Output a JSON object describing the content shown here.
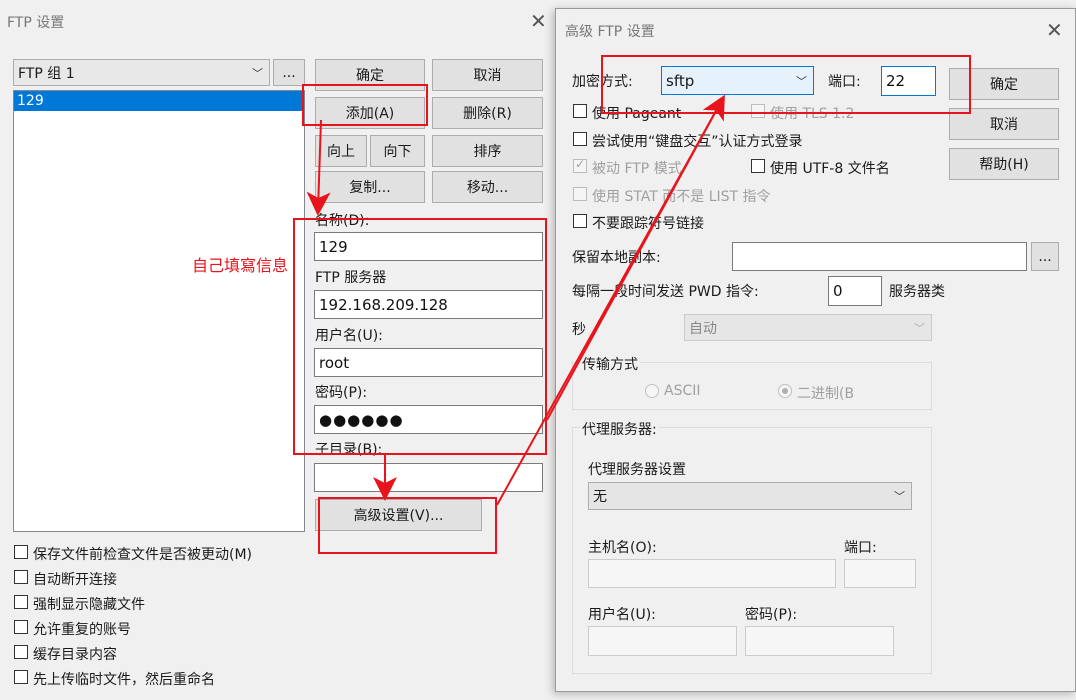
{
  "ftp_settings": {
    "title": "FTP 设置",
    "group_selected": "FTP 组 1",
    "group_more": "...",
    "list_items": [
      "129"
    ],
    "buttons": {
      "ok": "确定",
      "cancel": "取消",
      "add": "添加(A)",
      "delete": "删除(R)",
      "up": "向上",
      "down": "向下",
      "sort": "排序",
      "copy": "复制...",
      "move": "移动...",
      "advanced": "高级设置(V)..."
    },
    "fields": {
      "name_label": "名称(D):",
      "name_value": "129",
      "server_label": "FTP 服务器",
      "server_value": "192.168.209.128",
      "user_label": "用户名(U):",
      "user_value": "root",
      "pass_label": "密码(P):",
      "pass_value": "●●●●●●",
      "subdir_label": "子目录(B):",
      "subdir_value": ""
    },
    "options": [
      "保存文件前检查文件是否被更动(M)",
      "自动断开连接",
      "强制显示隐藏文件",
      "允许重复的账号",
      "缓存目录内容",
      "先上传临时文件，然后重命名"
    ]
  },
  "annotation": {
    "text": "自己填寫信息",
    "color": "#e8141c"
  },
  "advanced": {
    "title": "高级 FTP 设置",
    "encryption_label": "加密方式:",
    "encryption_value": "sftp",
    "port_label": "端口:",
    "port_value": "22",
    "ok": "确定",
    "cancel": "取消",
    "help": "帮助(H)",
    "use_pageant": "使用 Pageant",
    "use_tls": "使用 TLS 1.2",
    "keyboard_interactive": "尝试使用“键盘交互”认证方式登录",
    "passive_mode": "被动 FTP 模式",
    "use_utf8": "使用 UTF-8 文件名",
    "use_stat": "使用 STAT 而不是 LIST 指令",
    "no_symlink": "不要跟踪符号链接",
    "local_copy_label": "保留本地副本:",
    "local_copy_value": "",
    "local_copy_more": "...",
    "pwd_label": "每隔一段时间发送 PWD 指令:",
    "pwd_value": "0",
    "server_type_label": "服务器类",
    "seconds_label": "秒",
    "server_type_value": "自动",
    "transfer_title": "传输方式",
    "ascii": "ASCII",
    "binary": "二进制(B",
    "proxy_title": "代理服务器:",
    "proxy_settings_label": "代理服务器设置",
    "proxy_value": "无",
    "host_label": "主机名(O):",
    "proxy_port_label": "端口:",
    "proxy_user_label": "用户名(U):",
    "proxy_pass_label": "密码(P):"
  }
}
